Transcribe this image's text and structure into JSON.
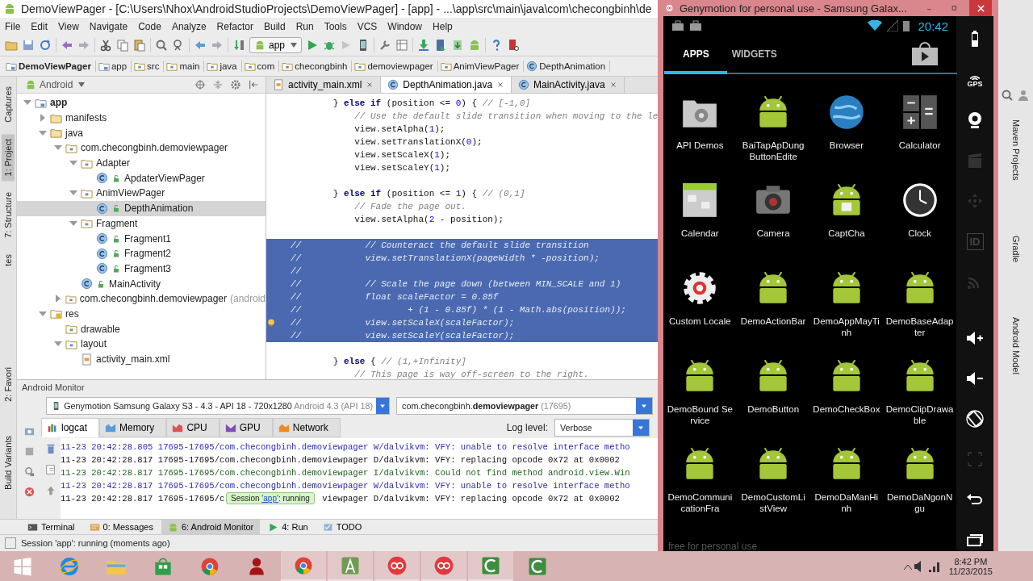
{
  "ide": {
    "title": "DemoViewPager - [C:\\Users\\Nhox\\AndroidStudioProjects\\DemoViewPager] - [app] - ...\\app\\src\\main\\java\\com\\checongbinh\\de",
    "menu": [
      "File",
      "Edit",
      "View",
      "Navigate",
      "Code",
      "Analyze",
      "Refactor",
      "Build",
      "Run",
      "Tools",
      "VCS",
      "Window",
      "Help"
    ],
    "run_config": "app",
    "breadcrumbs": [
      {
        "label": "DemoViewPager",
        "kind": "module"
      },
      {
        "label": "app",
        "kind": "module"
      },
      {
        "label": "src",
        "kind": "folder"
      },
      {
        "label": "main",
        "kind": "folder"
      },
      {
        "label": "java",
        "kind": "folder"
      },
      {
        "label": "com",
        "kind": "folder"
      },
      {
        "label": "checongbinh",
        "kind": "folder"
      },
      {
        "label": "demoviewpager",
        "kind": "folder"
      },
      {
        "label": "AnimViewPager",
        "kind": "folder"
      },
      {
        "label": "DepthAnimation",
        "kind": "class"
      }
    ],
    "left_tabs_top": [
      {
        "label": "Captures",
        "selected": false
      },
      {
        "label": "1: Project",
        "selected": true
      },
      {
        "label": "7: Structure",
        "selected": false
      },
      {
        "label": "tes",
        "selected": false
      }
    ],
    "left_tabs_bottom": [
      {
        "label": "2: Favori",
        "selected": false
      },
      {
        "label": "Build Variants",
        "selected": false
      }
    ],
    "project_view": "Android",
    "editor_tabs": [
      {
        "label": "activity_main.xml",
        "kind": "xml",
        "selected": false
      },
      {
        "label": "DepthAnimation.java",
        "kind": "class",
        "selected": true
      },
      {
        "label": "MainActivity.java",
        "kind": "class",
        "selected": false
      }
    ],
    "project_tree": [
      {
        "label": "app",
        "kind": "module",
        "bold": true,
        "expanded": true,
        "selected": false,
        "children": [
          {
            "label": "manifests",
            "kind": "folder",
            "expanded": false,
            "selected": false
          },
          {
            "label": "java",
            "kind": "folder",
            "expanded": true,
            "selected": false,
            "children": [
              {
                "label": "com.checongbinh.demoviewpager",
                "kind": "package",
                "expanded": true,
                "selected": false,
                "children": [
                  {
                    "label": "Adapter",
                    "kind": "package",
                    "expanded": true,
                    "selected": false,
                    "children": [
                      {
                        "label": "ApdaterViewPager",
                        "kind": "class",
                        "selected": false
                      }
                    ]
                  },
                  {
                    "label": "AnimViewPager",
                    "kind": "package",
                    "expanded": true,
                    "selected": false,
                    "children": [
                      {
                        "label": "DepthAnimation",
                        "kind": "class",
                        "selected": true
                      }
                    ]
                  },
                  {
                    "label": "Fragment",
                    "kind": "package",
                    "expanded": true,
                    "selected": false,
                    "children": [
                      {
                        "label": "Fragment1",
                        "kind": "class",
                        "selected": false
                      },
                      {
                        "label": "Fragment2",
                        "kind": "class",
                        "selected": false
                      },
                      {
                        "label": "Fragment3",
                        "kind": "class",
                        "selected": false
                      }
                    ]
                  },
                  {
                    "label": "MainActivity",
                    "kind": "class",
                    "selected": false
                  }
                ]
              },
              {
                "label": "com.checongbinh.demoviewpager",
                "note": "(android",
                "kind": "package",
                "expanded": false,
                "selected": false
              }
            ]
          },
          {
            "label": "res",
            "kind": "res",
            "expanded": true,
            "selected": false,
            "children": [
              {
                "label": "drawable",
                "kind": "package",
                "selected": false
              },
              {
                "label": "layout",
                "kind": "package",
                "expanded": true,
                "selected": false,
                "children": [
                  {
                    "label": "activity_main.xml",
                    "kind": "xml",
                    "selected": false
                  }
                ]
              }
            ]
          }
        ]
      }
    ],
    "code_lines": [
      {
        "selected": false,
        "segments": [
          {
            "text": "        } ",
            "kind": "plain"
          },
          {
            "text": "else if",
            "kind": "keyword"
          },
          {
            "text": " (position <= ",
            "kind": "plain"
          },
          {
            "text": "0",
            "kind": "number"
          },
          {
            "text": ") { ",
            "kind": "plain"
          },
          {
            "text": "// [-1,0]",
            "kind": "comment"
          }
        ]
      },
      {
        "selected": false,
        "segments": [
          {
            "text": "            // Use the default slide transition when moving to the le",
            "kind": "comment"
          }
        ]
      },
      {
        "selected": false,
        "segments": [
          {
            "text": "            view.setAlpha(",
            "kind": "plain"
          },
          {
            "text": "1",
            "kind": "number"
          },
          {
            "text": ");",
            "kind": "plain"
          }
        ]
      },
      {
        "selected": false,
        "segments": [
          {
            "text": "            view.setTranslationX(",
            "kind": "plain"
          },
          {
            "text": "0",
            "kind": "number"
          },
          {
            "text": ");",
            "kind": "plain"
          }
        ]
      },
      {
        "selected": false,
        "segments": [
          {
            "text": "            view.setScaleX(",
            "kind": "plain"
          },
          {
            "text": "1",
            "kind": "number"
          },
          {
            "text": ");",
            "kind": "plain"
          }
        ]
      },
      {
        "selected": false,
        "segments": [
          {
            "text": "            view.setScaleY(",
            "kind": "plain"
          },
          {
            "text": "1",
            "kind": "number"
          },
          {
            "text": ");",
            "kind": "plain"
          }
        ]
      },
      {
        "selected": false
      },
      {
        "selected": false,
        "segments": [
          {
            "text": "        } ",
            "kind": "plain"
          },
          {
            "text": "else if",
            "kind": "keyword"
          },
          {
            "text": " (position <= ",
            "kind": "plain"
          },
          {
            "text": "1",
            "kind": "number"
          },
          {
            "text": ") { ",
            "kind": "plain"
          },
          {
            "text": "// (0,1]",
            "kind": "comment"
          }
        ]
      },
      {
        "selected": false,
        "segments": [
          {
            "text": "            // Fade the page out.",
            "kind": "comment"
          }
        ]
      },
      {
        "selected": false,
        "segments": [
          {
            "text": "            view.setAlpha(",
            "kind": "plain"
          },
          {
            "text": "2",
            "kind": "number"
          },
          {
            "text": " - position);",
            "kind": "plain"
          }
        ]
      },
      {
        "selected": false
      },
      {
        "selected": true,
        "segments": [
          {
            "text": "//            // Counteract the default slide transition",
            "kind": "comment"
          }
        ]
      },
      {
        "selected": true,
        "segments": [
          {
            "text": "//            view.setTranslationX(pageWidth * -position);",
            "kind": "comment"
          }
        ]
      },
      {
        "selected": true,
        "segments": [
          {
            "text": "//",
            "kind": "comment"
          }
        ]
      },
      {
        "selected": true,
        "segments": [
          {
            "text": "//            // Scale the page down (between MIN_SCALE and 1)",
            "kind": "comment"
          }
        ]
      },
      {
        "selected": true,
        "segments": [
          {
            "text": "//            float scaleFactor = 0.85f",
            "kind": "comment"
          }
        ]
      },
      {
        "selected": true,
        "segments": [
          {
            "text": "//                    + (1 - 0.85f) * (1 - Math.abs(position));",
            "kind": "comment"
          }
        ]
      },
      {
        "selected": true,
        "bulb": true,
        "segments": [
          {
            "text": "//            view.setScaleX(scaleFactor);",
            "kind": "comment"
          }
        ]
      },
      {
        "selected": true,
        "segments": [
          {
            "text": "//            view.setScaleY(scaleFactor);",
            "kind": "comment"
          }
        ]
      },
      {
        "selected": false
      },
      {
        "selected": false,
        "segments": [
          {
            "text": "        } ",
            "kind": "plain"
          },
          {
            "text": "else",
            "kind": "keyword"
          },
          {
            "text": " { ",
            "kind": "plain"
          },
          {
            "text": "// (1,+Infinity]",
            "kind": "comment"
          }
        ]
      },
      {
        "selected": false,
        "segments": [
          {
            "text": "            // This page is way off-screen to the right.",
            "kind": "comment"
          }
        ]
      }
    ],
    "monitor": {
      "title": "Android Monitor",
      "device": "Genymotion Samsung Galaxy S3 - 4.3 - API 18 - 720x1280",
      "device_note": "Android 4.3 (API 18)",
      "process": "com.checongbinh.**demoviewpager**",
      "process_note": "(17695)",
      "tabs": [
        {
          "label": "logcat",
          "kind": "logcat",
          "selected": true
        },
        {
          "label": "Memory",
          "kind": "memory",
          "selected": false
        },
        {
          "label": "CPU",
          "kind": "cpu",
          "selected": false
        },
        {
          "label": "GPU",
          "kind": "gpu",
          "selected": false
        },
        {
          "label": "Network",
          "kind": "network",
          "selected": false
        }
      ],
      "log_level_label": "Log level:",
      "log_level": "Verbose",
      "log_lines": [
        {
          "text": "11-23 20:42:28.805 17695-17695/com.checongbinh.demoviewpager W/dalvikvm: VFY: unable to resolve interface metho",
          "kind": "warning"
        },
        {
          "text": "11-23 20:42:28.817 17695-17695/com.checongbinh.demoviewpager D/dalvikvm: VFY: replacing opcode 0x72 at 0x0002",
          "kind": "debug"
        },
        {
          "text": "11-23 20:42:28.817 17695-17695/com.checongbinh.demoviewpager I/dalvikvm: Could not find method android.view.Win",
          "kind": "info"
        },
        {
          "text": "11-23 20:42:28.817 17695-17695/com.checongbinh.demoviewpager W/dalvikvm: VFY: unable to resolve interface metho",
          "kind": "warning"
        },
        {
          "text": "11-23 20:42:28.817 17695-17695/c",
          "text_after": "viewpager D/dalvikvm: VFY: replacing opcode 0x72 at 0x0002",
          "kind": "debug"
        }
      ]
    },
    "tooltip": {
      "before": "Session ",
      "link": "'app'",
      "after": ": running"
    },
    "tool_windows": [
      {
        "label": "Terminal",
        "kind": "terminal",
        "selected": false
      },
      {
        "label": "0: Messages",
        "kind": "messages",
        "selected": false
      },
      {
        "label": "6: Android Monitor",
        "kind": "android",
        "selected": true
      },
      {
        "label": "4: Run",
        "kind": "run",
        "selected": false
      },
      {
        "label": "TODO",
        "kind": "todo",
        "selected": false
      }
    ],
    "status": "Session 'app': running (moments ago)",
    "right_tabs": [
      "Maven Projects",
      "Gradle",
      "Android Model"
    ]
  },
  "emulator": {
    "title": "Genymotion for personal use - Samsung Galax...",
    "clock": "20:42",
    "tabs": [
      {
        "label": "APPS",
        "selected": true
      },
      {
        "label": "WIDGETS",
        "selected": false
      }
    ],
    "apps": [
      {
        "label": "API Demos",
        "kind": "folder"
      },
      {
        "label": "BaiTapApDungButtonEdite",
        "kind": "android"
      },
      {
        "label": "Browser",
        "kind": "globe"
      },
      {
        "label": "Calculator",
        "kind": "calculator"
      },
      {
        "label": "Calendar",
        "kind": "calendar"
      },
      {
        "label": "Camera",
        "kind": "camera"
      },
      {
        "label": "CaptCha",
        "kind": "captcha"
      },
      {
        "label": "Clock",
        "kind": "clock"
      },
      {
        "label": "Custom Locale",
        "kind": "gear"
      },
      {
        "label": "DemoActionBar",
        "kind": "android"
      },
      {
        "label": "DemoAppMayTinh",
        "kind": "android"
      },
      {
        "label": "DemoBaseAdapter",
        "kind": "android"
      },
      {
        "label": "DemoBound Service",
        "kind": "android"
      },
      {
        "label": "DemoButton",
        "kind": "android"
      },
      {
        "label": "DemoCheckBox",
        "kind": "android"
      },
      {
        "label": "DemoClipDrawable",
        "kind": "android"
      },
      {
        "label": "DemoCommunicationFra",
        "kind": "android"
      },
      {
        "label": "DemoCustomListView",
        "kind": "android"
      },
      {
        "label": "DemoDaManHinh",
        "kind": "android"
      },
      {
        "label": "DemoDaNgonNgu",
        "kind": "android"
      }
    ],
    "side_controls": [
      {
        "kind": "battery"
      },
      {
        "kind": "gps",
        "label": "GPS"
      },
      {
        "kind": "webcam"
      },
      {
        "kind": "clapper"
      },
      {
        "kind": "dpad"
      },
      {
        "kind": "id",
        "label": "ID"
      },
      {
        "kind": "cast"
      },
      {
        "kind": "volume-up"
      },
      {
        "kind": "volume-down"
      },
      {
        "kind": "rotate"
      },
      {
        "kind": "scale"
      },
      {
        "kind": "back"
      },
      {
        "kind": "recent"
      }
    ],
    "footer": "free for personal use"
  },
  "taskbar": {
    "items": [
      {
        "kind": "start",
        "running": false
      },
      {
        "kind": "ie",
        "running": false
      },
      {
        "kind": "explorer",
        "running": false
      },
      {
        "kind": "store",
        "running": false
      },
      {
        "kind": "chrome",
        "running": false
      },
      {
        "kind": "figure",
        "running": false
      },
      {
        "kind": "chrome",
        "running": true
      },
      {
        "kind": "studio",
        "running": true
      },
      {
        "kind": "genymotion",
        "running": true
      },
      {
        "kind": "genymotion",
        "running": true
      },
      {
        "kind": "camtasia",
        "running": true
      },
      {
        "kind": "camtasia",
        "running": false
      }
    ],
    "time": "8:42 PM",
    "date": "11/23/2015"
  }
}
